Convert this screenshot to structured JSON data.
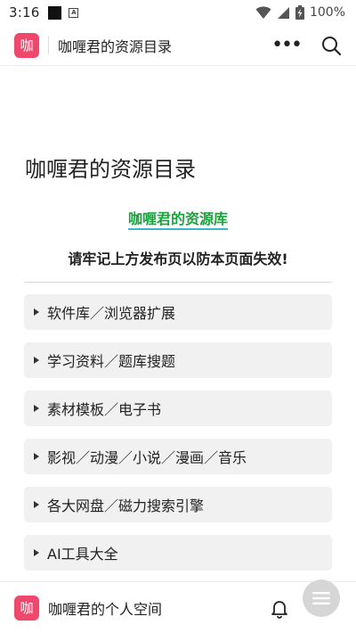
{
  "status_bar": {
    "time": "3:16",
    "battery_percent": "100%",
    "notification_letter": "A",
    "icons": [
      "notification-square-icon",
      "notification-a-icon",
      "wifi-icon",
      "signal-icon",
      "battery-icon"
    ]
  },
  "header": {
    "logo_char": "咖",
    "title": "咖喱君的资源目录",
    "actions": [
      "more-icon",
      "search-icon"
    ]
  },
  "page": {
    "title": "咖喱君的资源目录",
    "link_text": "咖喱君的资源库",
    "notice": "请牢记上方发布页以防本页面失效!"
  },
  "toggles": [
    {
      "label": "软件库／浏览器扩展"
    },
    {
      "label": "学习资料／题库搜题"
    },
    {
      "label": "素材模板／电子书"
    },
    {
      "label": "影视／动漫／小说／漫画／音乐"
    },
    {
      "label": "各大网盘／磁力搜索引擎"
    },
    {
      "label": "AI工具大全"
    }
  ],
  "bottom_bar": {
    "logo_char": "咖",
    "title": "咖喱君的个人空间",
    "actions": [
      "bell-icon",
      "menu-icon"
    ]
  },
  "colors": {
    "accent": "#f0476d",
    "link": "#18a33b",
    "link_underline": "#3fb4c5",
    "toggle_bg": "#f1f1f1"
  }
}
